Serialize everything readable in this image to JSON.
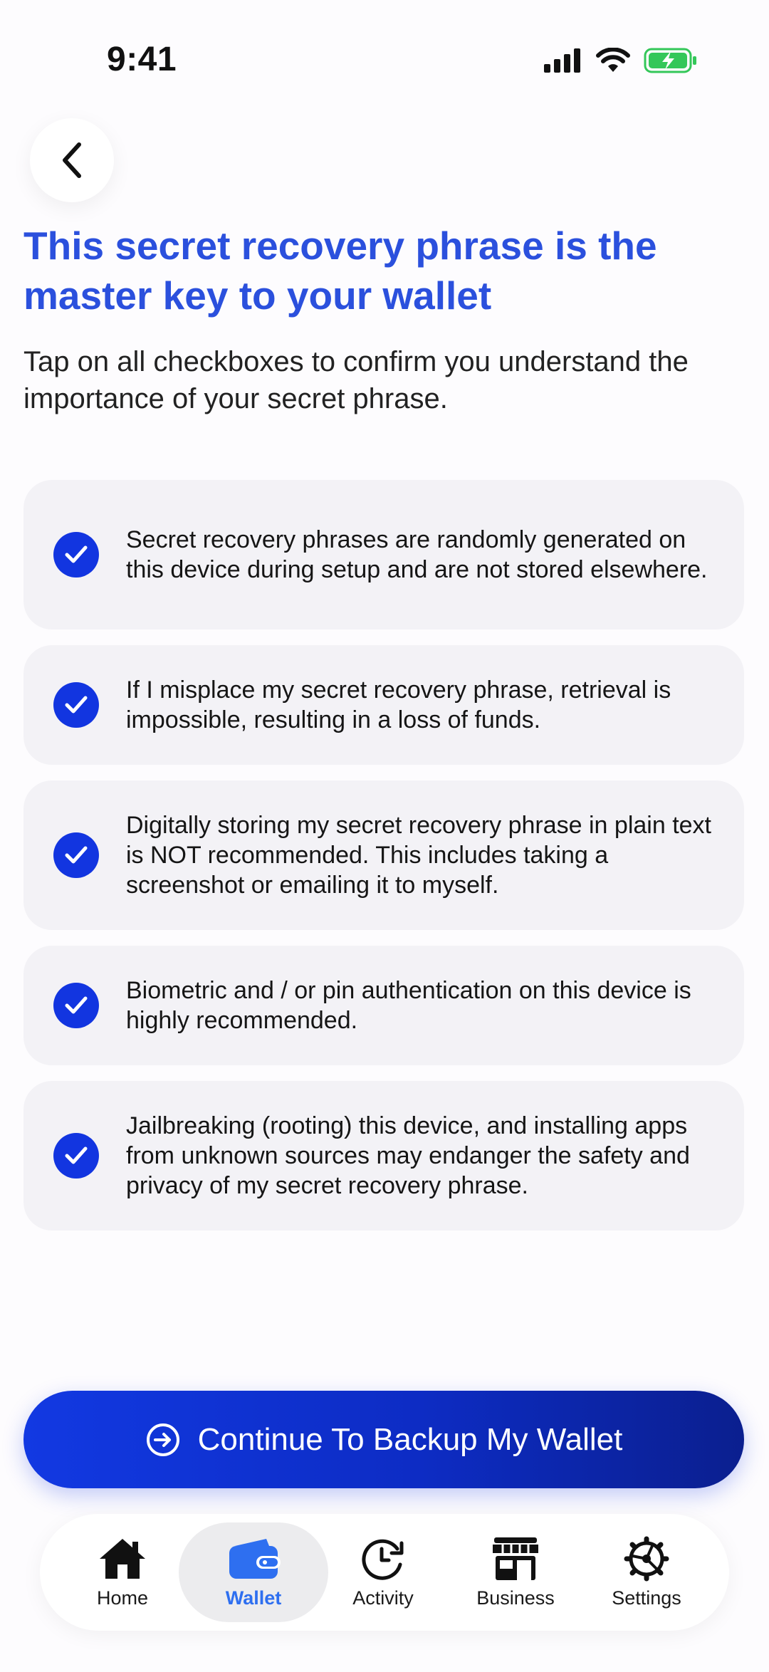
{
  "status_bar": {
    "time": "9:41",
    "icons": [
      "cellular-signal-icon",
      "wifi-icon",
      "battery-charging-icon"
    ]
  },
  "header": {
    "back_icon": "chevron-left-icon",
    "title": "This secret recovery phrase is the master key to your wallet",
    "subtitle": "Tap on all checkboxes to confirm you understand the importance of your secret phrase."
  },
  "checklist": [
    {
      "text": "Secret recovery phrases are randomly generated on this device during setup and are not stored elsewhere.",
      "checked": true
    },
    {
      "text": "If I misplace my secret recovery phrase, retrieval is impossible, resulting in a loss of funds.",
      "checked": true
    },
    {
      "text": "Digitally storing my secret recovery phrase in plain text is NOT recommended. This includes taking a screenshot or emailing it to myself.",
      "checked": true
    },
    {
      "text": "Biometric and / or pin authentication on this device is highly recommended.",
      "checked": true
    },
    {
      "text": "Jailbreaking (rooting) this device, and installing apps from unknown sources may endanger the safety and privacy of my secret recovery phrase.",
      "checked": true
    }
  ],
  "cta": {
    "label": "Continue To Backup My Wallet",
    "icon": "arrow-right-circle-icon"
  },
  "tabs": [
    {
      "label": "Home",
      "icon": "home-icon",
      "active": false
    },
    {
      "label": "Wallet",
      "icon": "wallet-icon",
      "active": true
    },
    {
      "label": "Activity",
      "icon": "clock-icon",
      "active": false
    },
    {
      "label": "Business",
      "icon": "store-icon",
      "active": false
    },
    {
      "label": "Settings",
      "icon": "gear-icon",
      "active": false
    }
  ],
  "colors": {
    "title": "#2b50dd",
    "accent": "#1235e0",
    "active_tab": "#2e6ff0",
    "battery": "#34c759"
  }
}
